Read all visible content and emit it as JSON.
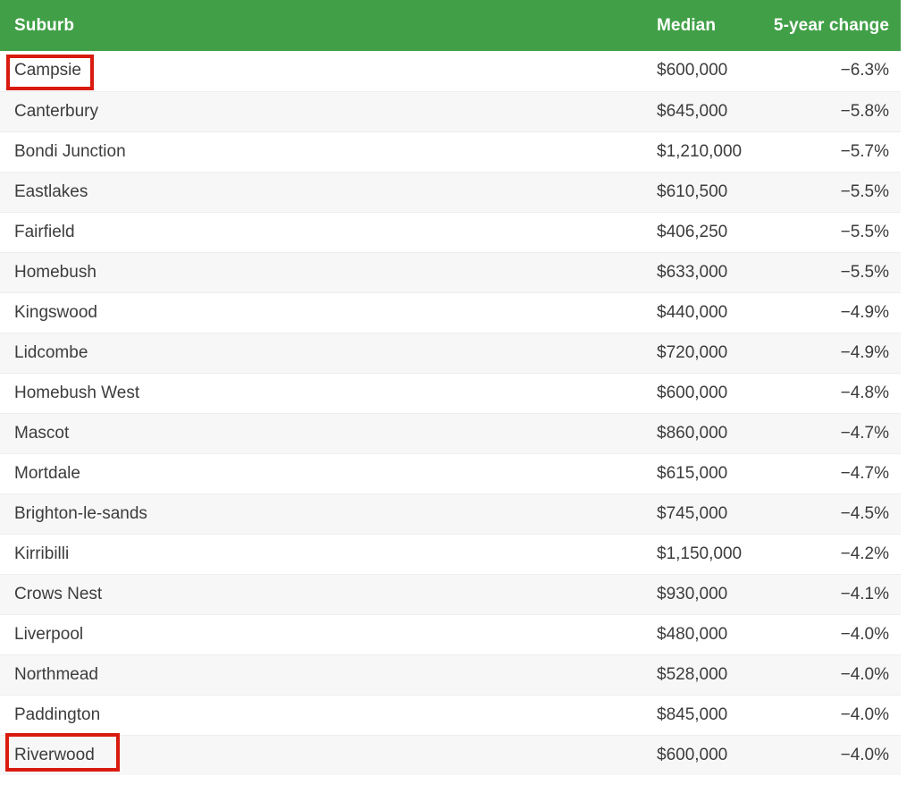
{
  "table": {
    "columns": [
      {
        "key": "suburb",
        "label": "Suburb"
      },
      {
        "key": "median",
        "label": "Median"
      },
      {
        "key": "change",
        "label": "5-year change"
      }
    ],
    "header_background": "#41a047",
    "header_text_color": "#ffffff",
    "highlight_color": "#d91a0f",
    "rows": [
      {
        "suburb": "Campsie",
        "median": "$600,000",
        "change": "−6.3%",
        "highlighted": true
      },
      {
        "suburb": "Canterbury",
        "median": "$645,000",
        "change": "−5.8%",
        "highlighted": false
      },
      {
        "suburb": "Bondi Junction",
        "median": "$1,210,000",
        "change": "−5.7%",
        "highlighted": false
      },
      {
        "suburb": "Eastlakes",
        "median": "$610,500",
        "change": "−5.5%",
        "highlighted": false
      },
      {
        "suburb": "Fairfield",
        "median": "$406,250",
        "change": "−5.5%",
        "highlighted": false
      },
      {
        "suburb": "Homebush",
        "median": "$633,000",
        "change": "−5.5%",
        "highlighted": false
      },
      {
        "suburb": "Kingswood",
        "median": "$440,000",
        "change": "−4.9%",
        "highlighted": false
      },
      {
        "suburb": "Lidcombe",
        "median": "$720,000",
        "change": "−4.9%",
        "highlighted": false
      },
      {
        "suburb": "Homebush West",
        "median": "$600,000",
        "change": "−4.8%",
        "highlighted": false
      },
      {
        "suburb": "Mascot",
        "median": "$860,000",
        "change": "−4.7%",
        "highlighted": false
      },
      {
        "suburb": "Mortdale",
        "median": "$615,000",
        "change": "−4.7%",
        "highlighted": false
      },
      {
        "suburb": "Brighton-le-sands",
        "median": "$745,000",
        "change": "−4.5%",
        "highlighted": false
      },
      {
        "suburb": "Kirribilli",
        "median": "$1,150,000",
        "change": "−4.2%",
        "highlighted": false
      },
      {
        "suburb": "Crows Nest",
        "median": "$930,000",
        "change": "−4.1%",
        "highlighted": false
      },
      {
        "suburb": "Liverpool",
        "median": "$480,000",
        "change": "−4.0%",
        "highlighted": false
      },
      {
        "suburb": "Northmead",
        "median": "$528,000",
        "change": "−4.0%",
        "highlighted": false
      },
      {
        "suburb": "Paddington",
        "median": "$845,000",
        "change": "−4.0%",
        "highlighted": false
      },
      {
        "suburb": "Riverwood",
        "median": "$600,000",
        "change": "−4.0%",
        "highlighted": true
      }
    ]
  }
}
